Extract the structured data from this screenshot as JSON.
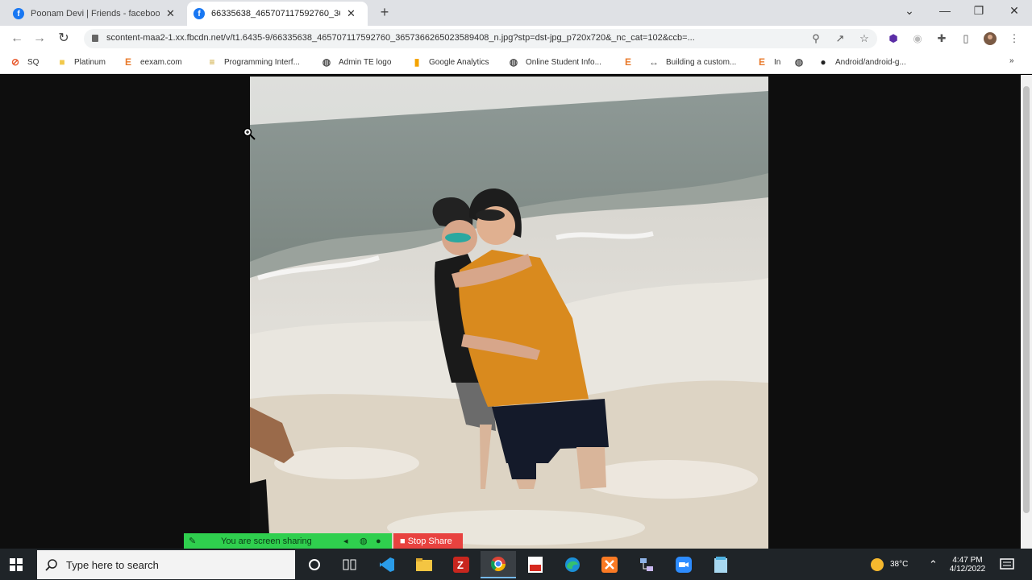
{
  "browser": {
    "tabs": [
      {
        "title": "Poonam Devi | Friends - faceboo",
        "active": false
      },
      {
        "title": "66335638_465707117592760_36",
        "active": true
      }
    ],
    "new_tab": "+",
    "url": "scontent-maa2-1.xx.fbcdn.net/v/t1.6435-9/66335638_465707117592760_3657366265023589408_n.jpg?stp=dst-jpg_p720x720&_nc_cat=102&ccb=...",
    "window_controls": {
      "dropdown": "⌄",
      "minimize": "—",
      "restore": "❐",
      "close": "✕"
    },
    "nav": {
      "back": "←",
      "forward": "→",
      "reload": "↻"
    }
  },
  "bookmarks": [
    {
      "label": "SQ",
      "icon": "link-icon",
      "color": "#e8572a"
    },
    {
      "label": "Platinum",
      "icon": "folder-icon",
      "color": "#f2c94c"
    },
    {
      "label": "eexam.com",
      "icon": "e-logo-icon",
      "color": "#e8792a"
    },
    {
      "label": "Programming Interf...",
      "icon": "bookmark-icon",
      "color": "#c9a227"
    },
    {
      "label": "Admin TE logo",
      "icon": "globe-icon",
      "color": "#555555"
    },
    {
      "label": "Google Analytics",
      "icon": "analytics-icon",
      "color": "#f4a300"
    },
    {
      "label": "Online Student Info...",
      "icon": "globe-icon",
      "color": "#555555"
    },
    {
      "label": "",
      "icon": "e-logo-icon",
      "color": "#e8792a"
    },
    {
      "label": "Building a custom...",
      "icon": "code-icon",
      "color": "#555555"
    },
    {
      "label": "In",
      "icon": "e-logo-icon",
      "color": "#e8792a"
    },
    {
      "label": "",
      "icon": "globe-icon",
      "color": "#555555"
    },
    {
      "label": "Android/android-g...",
      "icon": "github-icon",
      "color": "#222222"
    }
  ],
  "bookmarks_more": "»",
  "screen_share": {
    "status": "You are screen sharing",
    "stop": "Stop Share"
  },
  "taskbar": {
    "search_placeholder": "Type here to search",
    "apps": [
      "cortana-icon",
      "task-view-icon",
      "vscode-icon",
      "file-explorer-icon",
      "filezilla-icon",
      "chrome-icon",
      "acrobat-icon",
      "edge-icon",
      "xampp-icon",
      "network-tool-icon",
      "zoom-icon",
      "notepad-icon"
    ],
    "weather": "38°C",
    "time": "4:47 PM",
    "date": "4/12/2022"
  },
  "colors": {
    "share_green": "#2fcf4e",
    "share_red": "#e8423f",
    "taskbar_bg": "#1f2428",
    "facebook_blue": "#1877f2"
  }
}
